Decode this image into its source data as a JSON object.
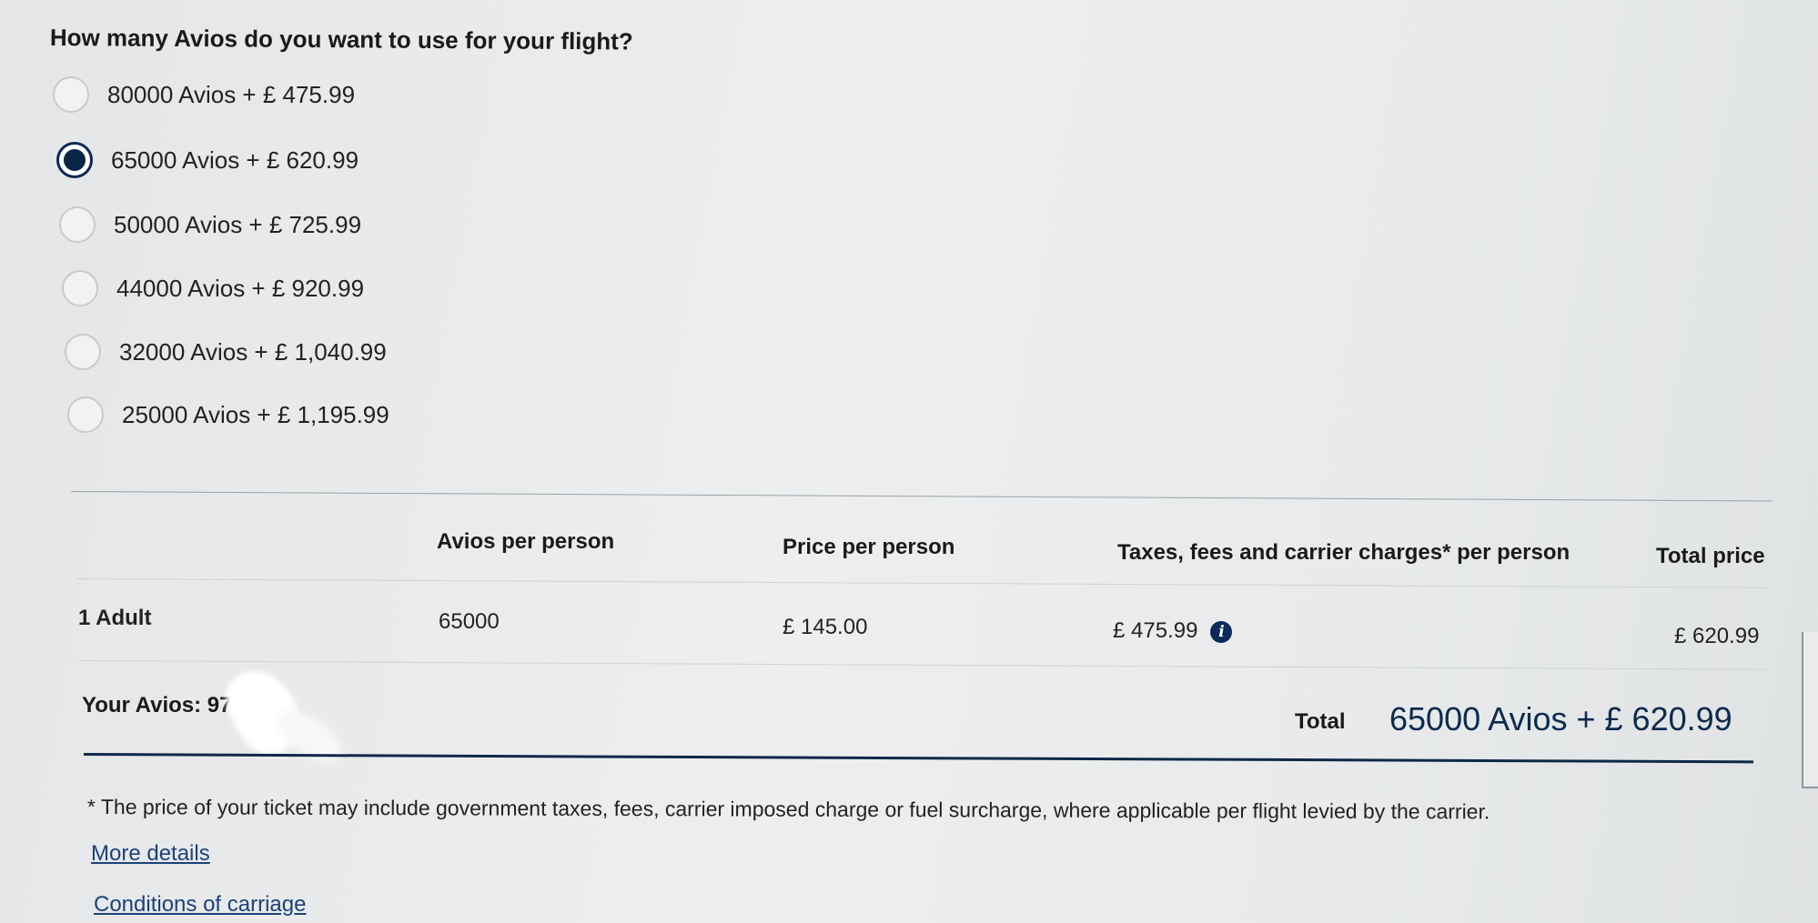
{
  "question": "How many Avios do you want to use for your flight?",
  "options": [
    {
      "label": "80000 Avios + £ 475.99",
      "selected": false
    },
    {
      "label": "65000 Avios + £ 620.99",
      "selected": true
    },
    {
      "label": "50000 Avios + £ 725.99",
      "selected": false
    },
    {
      "label": "44000 Avios + £ 920.99",
      "selected": false
    },
    {
      "label": "32000 Avios + £ 1,040.99",
      "selected": false
    },
    {
      "label": "25000 Avios + £ 1,195.99",
      "selected": false
    }
  ],
  "table": {
    "headers": {
      "avios": "Avios per person",
      "price": "Price per person",
      "taxes": "Taxes, fees and carrier charges* per person",
      "total": "Total price"
    },
    "row": {
      "passenger": "1 Adult",
      "avios": "65000",
      "price": "£ 145.00",
      "taxes": "£ 475.99",
      "total": "£ 620.99"
    }
  },
  "your_avios": "Your Avios: 97",
  "total": {
    "label": "Total",
    "value": "65000 Avios + £ 620.99"
  },
  "note": "* The price of your ticket may include government taxes, fees, carrier imposed charge or fuel surcharge, where applicable per flight levied by the carrier.",
  "links": {
    "more_details": "More details",
    "conditions": "Conditions of carriage"
  },
  "icons": {
    "info": "info-icon"
  },
  "colors": {
    "accent": "#0b2546",
    "link": "#1b4279",
    "total_text": "#0d2a4e"
  }
}
